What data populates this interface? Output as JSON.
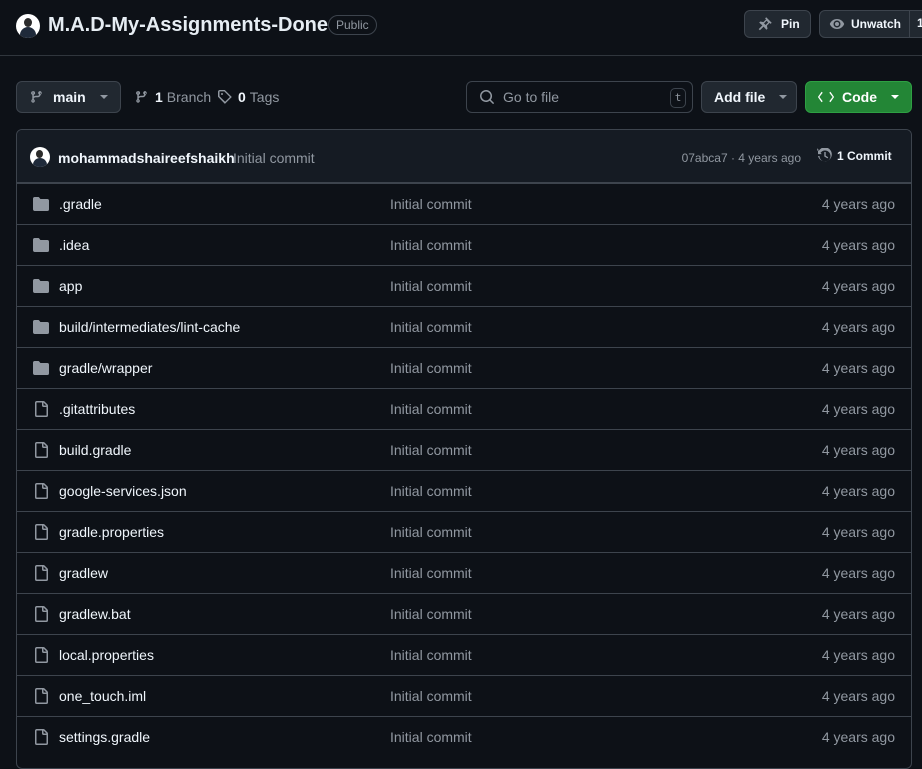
{
  "repo": {
    "name": "M.A.D-My-Assignments-Done",
    "visibility": "Public"
  },
  "actions": {
    "pin_label": "Pin",
    "unwatch_label": "Unwatch",
    "watch_count": "1"
  },
  "toolbar": {
    "branch": "main",
    "branch_count": "1",
    "branch_label": "Branch",
    "tag_count": "0",
    "tag_label": "Tags",
    "search_placeholder": "Go to file",
    "search_shortcut": "t",
    "add_file_label": "Add file",
    "code_label": "Code"
  },
  "latest_commit": {
    "author": "mohammadshaireefshaikh",
    "message": "Initial commit",
    "info": "07abca7 · 4 years ago",
    "count_label": "1 Commit"
  },
  "files": [
    {
      "type": "folder",
      "name": ".gradle",
      "commit": "Initial commit",
      "age": "4 years ago"
    },
    {
      "type": "folder",
      "name": ".idea",
      "commit": "Initial commit",
      "age": "4 years ago"
    },
    {
      "type": "folder",
      "name": "app",
      "commit": "Initial commit",
      "age": "4 years ago"
    },
    {
      "type": "folder",
      "name": "build/intermediates/lint-cache",
      "commit": "Initial commit",
      "age": "4 years ago"
    },
    {
      "type": "folder",
      "name": "gradle/wrapper",
      "commit": "Initial commit",
      "age": "4 years ago"
    },
    {
      "type": "file",
      "name": ".gitattributes",
      "commit": "Initial commit",
      "age": "4 years ago"
    },
    {
      "type": "file",
      "name": "build.gradle",
      "commit": "Initial commit",
      "age": "4 years ago"
    },
    {
      "type": "file",
      "name": "google-services.json",
      "commit": "Initial commit",
      "age": "4 years ago"
    },
    {
      "type": "file",
      "name": "gradle.properties",
      "commit": "Initial commit",
      "age": "4 years ago"
    },
    {
      "type": "file",
      "name": "gradlew",
      "commit": "Initial commit",
      "age": "4 years ago"
    },
    {
      "type": "file",
      "name": "gradlew.bat",
      "commit": "Initial commit",
      "age": "4 years ago"
    },
    {
      "type": "file",
      "name": "local.properties",
      "commit": "Initial commit",
      "age": "4 years ago"
    },
    {
      "type": "file",
      "name": "one_touch.iml",
      "commit": "Initial commit",
      "age": "4 years ago"
    },
    {
      "type": "file",
      "name": "settings.gradle",
      "commit": "Initial commit",
      "age": "4 years ago"
    }
  ],
  "icons": {
    "folder": "folder-icon",
    "file": "file-icon"
  },
  "colors": {
    "background": "#0d1117",
    "primary_button": "#238636",
    "border": "#3d444d",
    "muted_text": "#9198a1"
  }
}
